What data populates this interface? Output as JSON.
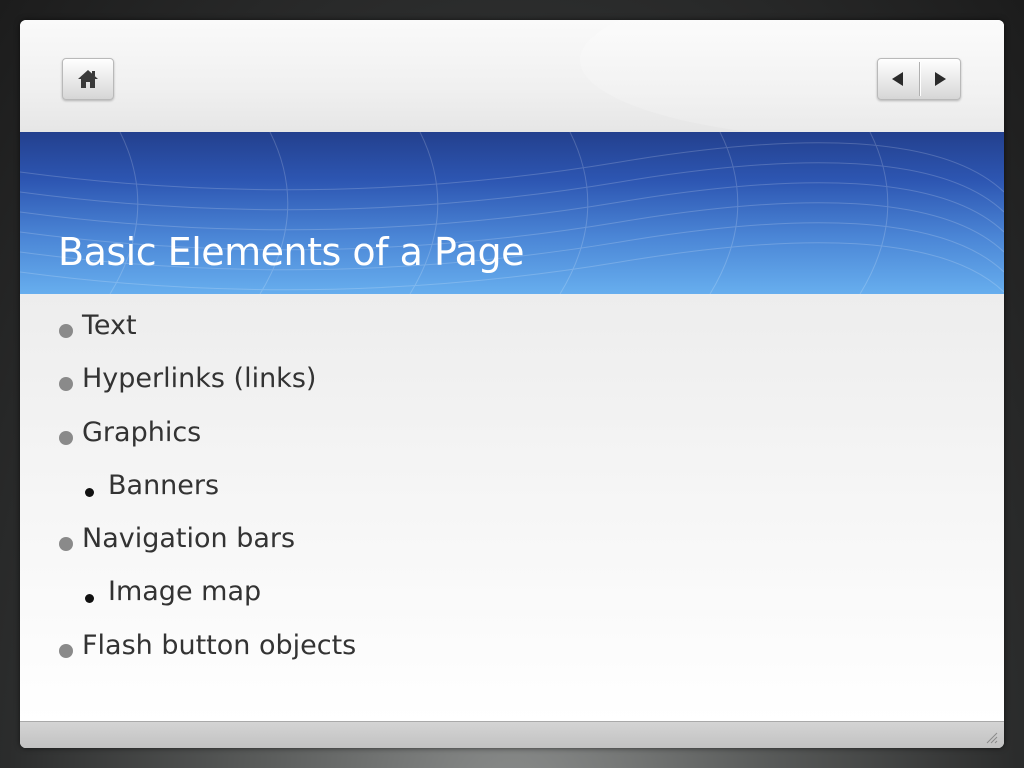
{
  "slide": {
    "title": "Basic Elements of a Page",
    "bullets": [
      {
        "text": "Text",
        "level": 1
      },
      {
        "text": "Hyperlinks (links)",
        "level": 1
      },
      {
        "text": "Graphics",
        "level": 1
      },
      {
        "text": "Banners",
        "level": 2
      },
      {
        "text": "Navigation bars",
        "level": 1
      },
      {
        "text": "Image map",
        "level": 2
      },
      {
        "text": "Flash button objects",
        "level": 1
      }
    ]
  },
  "navigation": {
    "home_icon": "home-icon",
    "prev_icon": "triangle-left-icon",
    "next_icon": "triangle-right-icon"
  },
  "colors": {
    "title_band_top": "#23408e",
    "title_band_bottom": "#67aeee",
    "title_text": "#ffffff",
    "body_text": "#333333",
    "bullet_level_1": "#8a8a8a",
    "bullet_level_2": "#111111"
  }
}
